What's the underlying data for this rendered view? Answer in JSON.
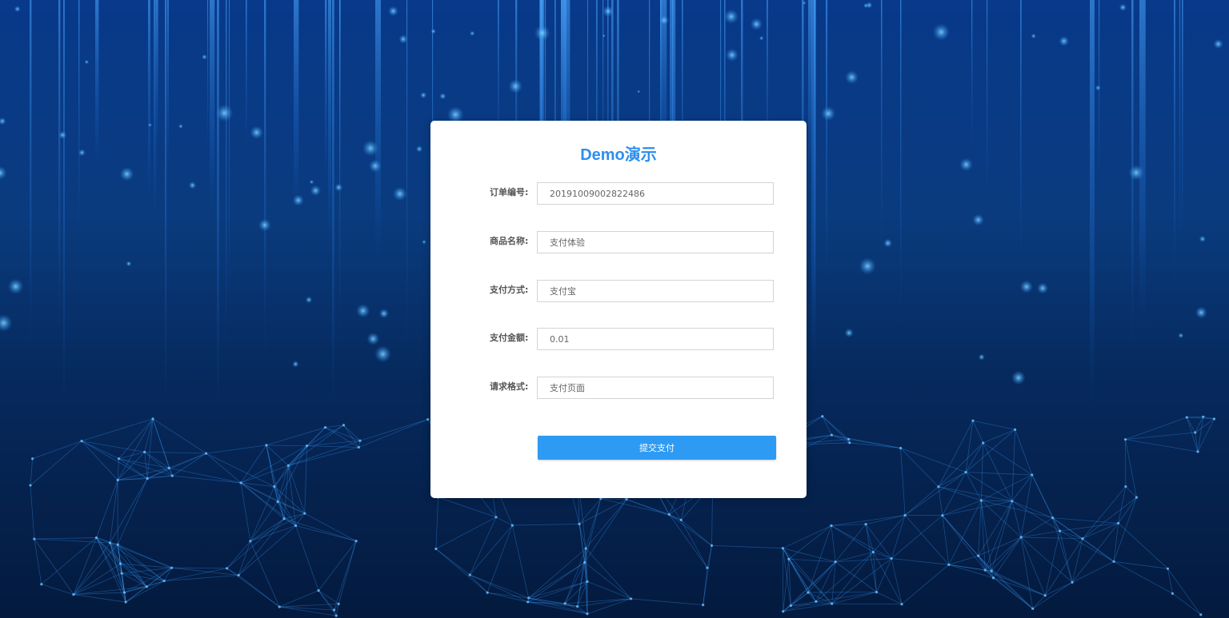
{
  "form": {
    "title": "Demo演示",
    "fields": [
      {
        "label": "订单编号:",
        "value": "20191009002822486"
      },
      {
        "label": "商品名称:",
        "value": "支付体验"
      },
      {
        "label": "支付方式:",
        "value": "支付宝"
      },
      {
        "label": "支付金额:",
        "value": "0.01"
      },
      {
        "label": "请求格式:",
        "value": "支付页面"
      }
    ],
    "submit_label": "提交支付"
  },
  "colors": {
    "accent": "#2d9af3",
    "title": "#2d8ef0",
    "background": "#0a3b7e"
  }
}
